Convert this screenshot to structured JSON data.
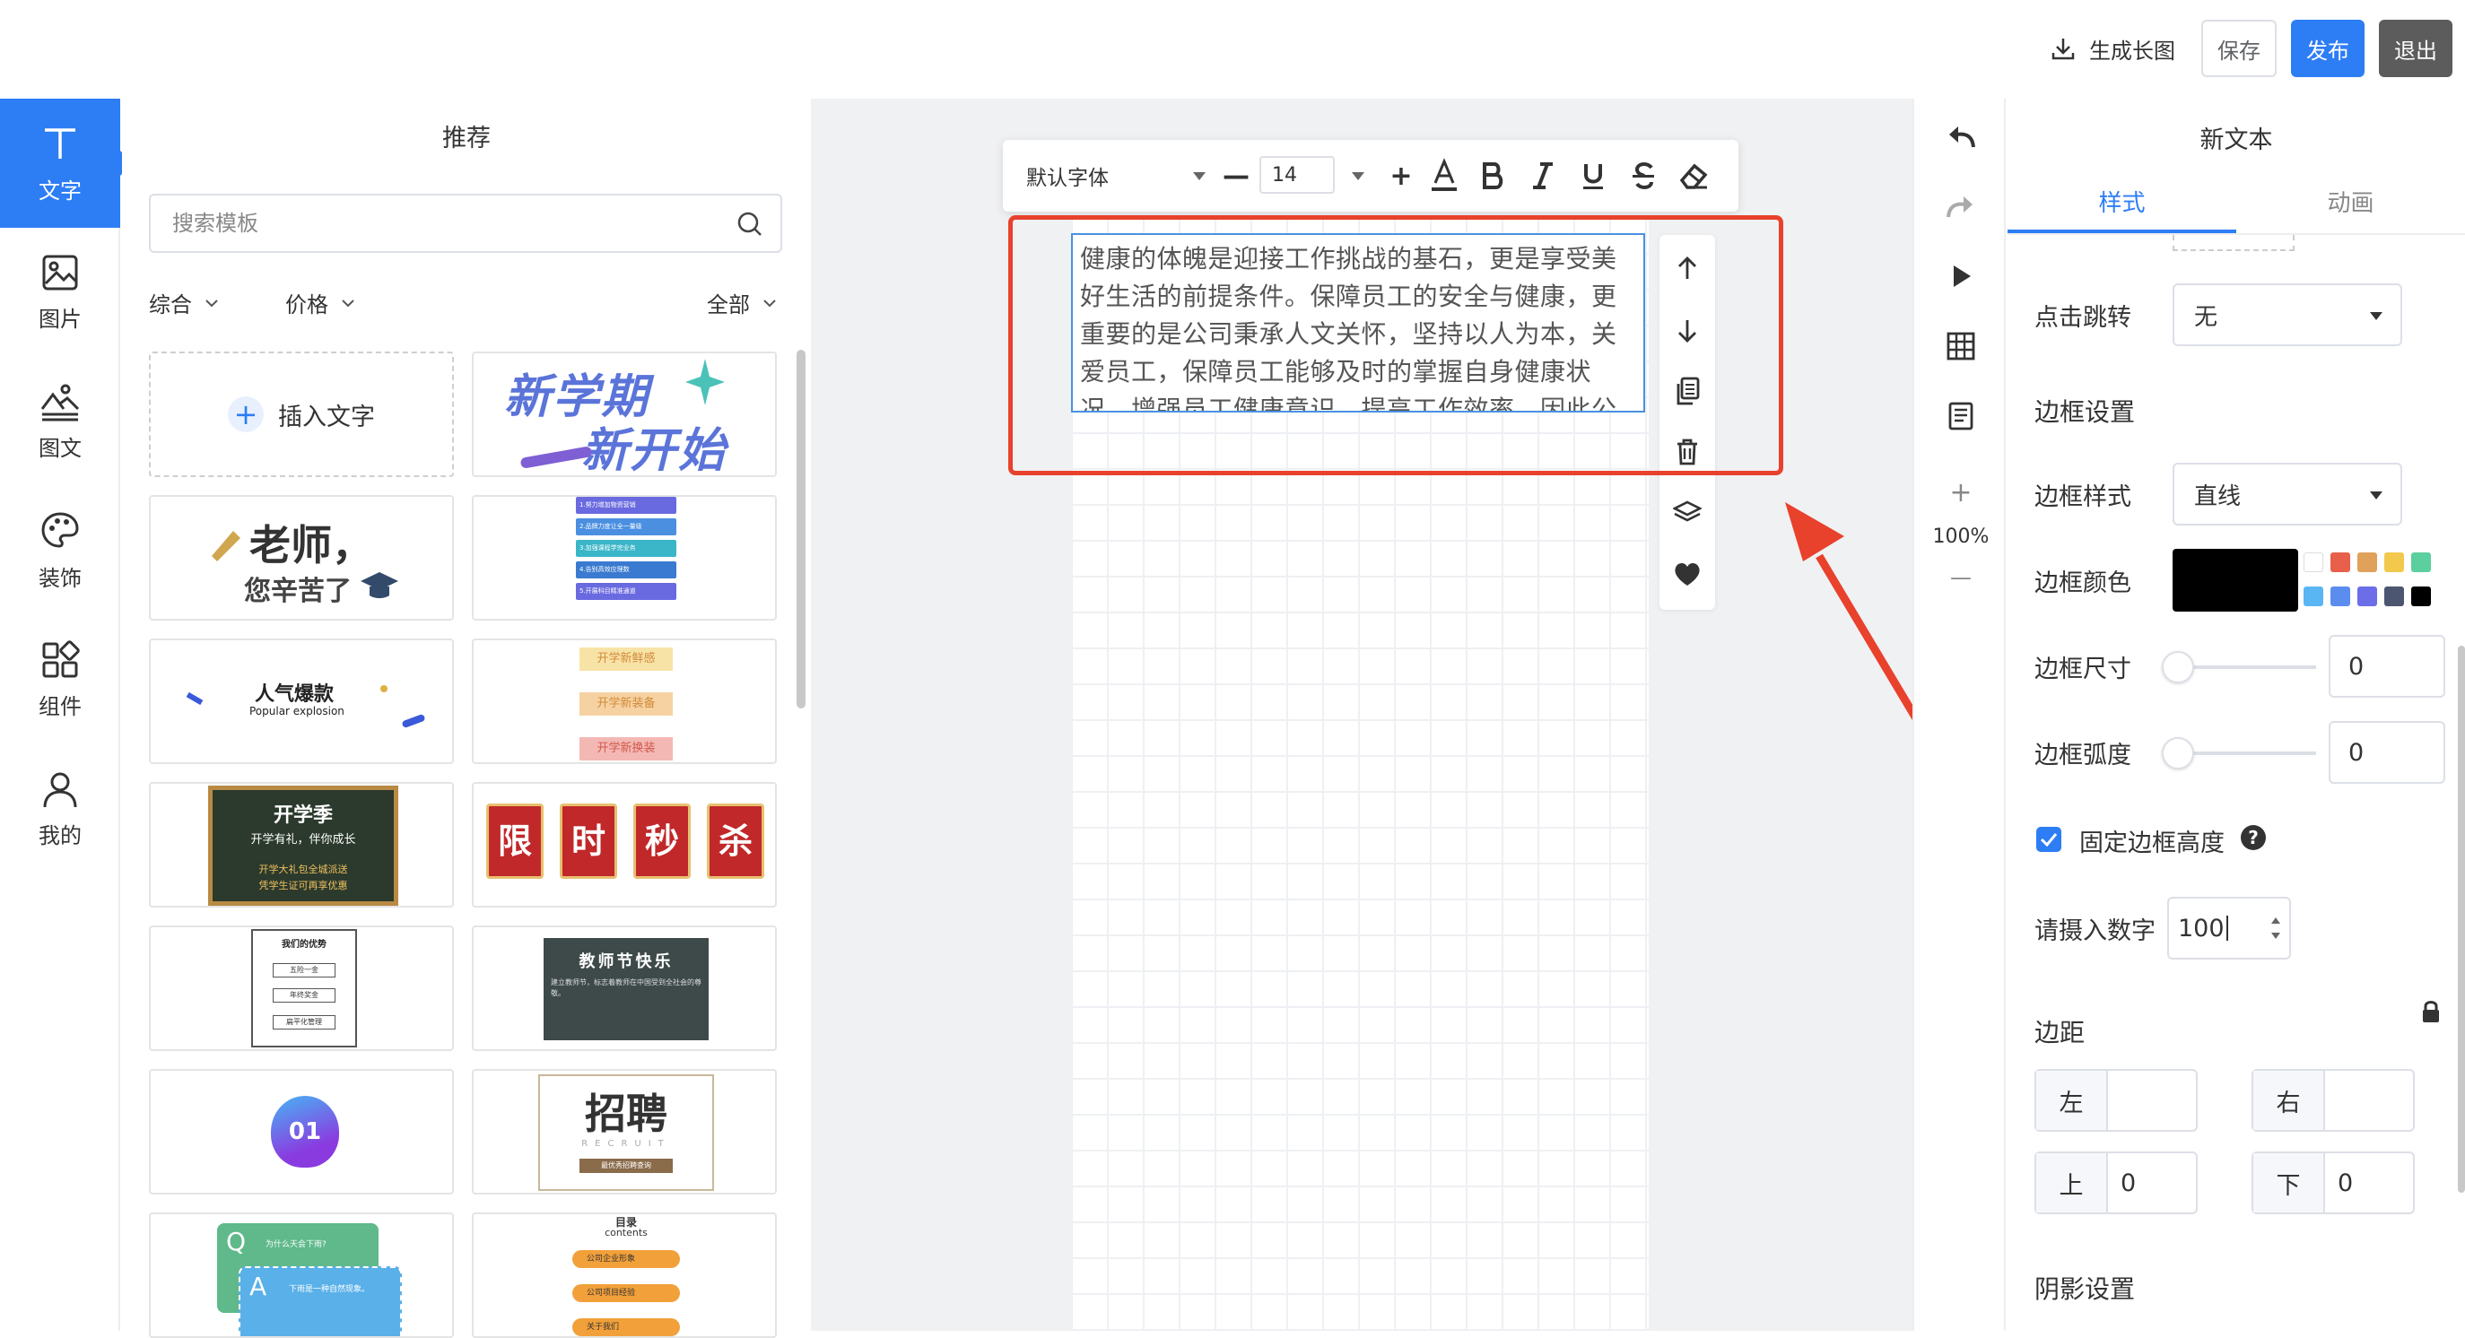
{
  "toolbar": {
    "export_label": "生成长图",
    "save_label": "保存",
    "publish_label": "发布",
    "exit_label": "退出"
  },
  "rail": {
    "items": [
      {
        "label": "文字",
        "icon": "text-icon",
        "active": true
      },
      {
        "label": "图片",
        "icon": "image-icon"
      },
      {
        "label": "图文",
        "icon": "image-text-icon"
      },
      {
        "label": "装饰",
        "icon": "palette-icon"
      },
      {
        "label": "组件",
        "icon": "components-icon"
      },
      {
        "label": "我的",
        "icon": "user-icon"
      }
    ]
  },
  "templates": {
    "title": "推荐",
    "search_placeholder": "搜索模板",
    "filters": {
      "sort": "综合",
      "price": "价格",
      "scope": "全部"
    },
    "insert_label": "插入文字",
    "tiles": [
      {
        "id": "new-term",
        "lines": [
          "新学期",
          "新开始"
        ]
      },
      {
        "id": "teacher",
        "lines": [
          "老师，",
          "您辛苦了"
        ]
      },
      {
        "id": "blue-steps",
        "lines": [
          "1.努力增加物资营销",
          "2.品牌力度让全一量级",
          "3.加强课程学完业务",
          "4.告别高效应理数",
          "5.开展科目精准通道"
        ]
      },
      {
        "id": "popular",
        "lines": [
          "人气爆款",
          "Popular explosion"
        ]
      },
      {
        "id": "ribbons",
        "lines": [
          "开学新鲜感",
          "开学新装备",
          "开学新换装"
        ]
      },
      {
        "id": "blackboard",
        "lines": [
          "开学季",
          "开学有礼，伴你成长",
          "开学大礼包全城派送",
          "凭学生证可再享优惠"
        ]
      },
      {
        "id": "flash-sale",
        "lines": [
          "限",
          "时",
          "秒",
          "杀"
        ]
      },
      {
        "id": "advantages",
        "lines": [
          "我们的优势",
          "五险一金",
          "年终奖金",
          "扁平化管理"
        ]
      },
      {
        "id": "teachers-day",
        "lines": [
          "教师节快乐",
          "建立教师节，标志着教师在中国受到全社会的尊敬。"
        ]
      },
      {
        "id": "badge-01",
        "lines": [
          "01"
        ]
      },
      {
        "id": "recruit",
        "lines": [
          "招聘",
          "RECRUIT",
          "最优秀招聘查询"
        ]
      },
      {
        "id": "qa",
        "lines": [
          "Q",
          "为什么天会下雨?",
          "A",
          "下雨是一种自然现象。"
        ]
      },
      {
        "id": "contents",
        "lines": [
          "目录",
          "contents",
          "公司企业形象",
          "公司项目经验",
          "关于我们"
        ]
      }
    ]
  },
  "text_toolbar": {
    "font": "默认字体",
    "size": "14",
    "minus": "—",
    "plus": "+"
  },
  "canvas": {
    "selected_text": "健康的体魄是迎接工作挑战的基石，更是享受美好生活的前提条件。保障员工的安全与健康，更重要的是公司秉承人文关怀，坚持以人为本，关爱员工，保障员工能够及时的掌握自身健康状况，增强员工健康意识，提高工作效率。因此公司为全体"
  },
  "mini": {
    "zoom": "100%",
    "zoom_in": "+",
    "zoom_out": "—"
  },
  "props": {
    "title": "新文本",
    "tabs": [
      "样式",
      "动画"
    ],
    "link_label": "点击跳转",
    "link_value": "无",
    "border_section": "边框设置",
    "border_style_label": "边框样式",
    "border_style_value": "直线",
    "border_color_label": "边框颜色",
    "border_color": "#000000",
    "border_size_label": "边框尺寸",
    "border_size": "0",
    "border_radius_label": "边框弧度",
    "border_radius": "0",
    "fixed_height_label": "固定边框高度",
    "fixed_height_checked": true,
    "help": "?",
    "number_label": "请摄入数字",
    "number_value": "100",
    "padding_section": "边距",
    "padding": {
      "left_label": "左",
      "left_value": "",
      "right_label": "右",
      "right_value": "",
      "top_label": "上",
      "top_value": "0",
      "bottom_label": "下",
      "bottom_value": "0"
    },
    "shadow_section": "阴影设置",
    "swatches": [
      "#ffffff",
      "#e8604c",
      "#e0a15a",
      "#f2c94c",
      "#5ccf9f",
      "#5ab6f2",
      "#5b8def",
      "#6c6ee8",
      "#4c5670",
      "#000000"
    ]
  },
  "colors": {
    "accent": "#2d7df5",
    "highlight": "#e8412c"
  }
}
